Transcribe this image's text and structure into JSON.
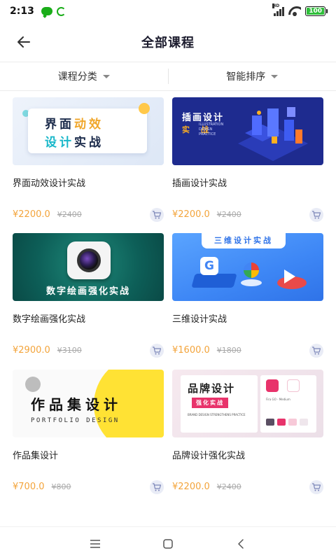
{
  "status_bar": {
    "time": "2:13",
    "battery": "100",
    "icons": [
      "wechat-icon",
      "sync-icon",
      "signal-icon",
      "wifi-icon",
      "battery-icon"
    ]
  },
  "header": {
    "title": "全部课程",
    "back_icon": "arrow-left-icon"
  },
  "filters": {
    "category_label": "课程分类",
    "sort_label": "智能排序"
  },
  "courses": [
    {
      "title": "界面动效设计实战",
      "price": "¥2200.0",
      "old_price": "¥2400",
      "thumb_line1_a": "界面",
      "thumb_line1_b": "动效",
      "thumb_line2_a": "设计",
      "thumb_line2_b": "实战"
    },
    {
      "title": "插画设计实战",
      "price": "¥2200.0",
      "old_price": "¥2400",
      "thumb_title": "插画设计",
      "thumb_sub": "实 战",
      "thumb_tiny": "ILLUSTRATION DESIGN PRACTICE"
    },
    {
      "title": "数字绘画强化实战",
      "price": "¥2900.0",
      "old_price": "¥3100",
      "thumb_text": "数字绘画强化实战"
    },
    {
      "title": "三维设计实战",
      "price": "¥1600.0",
      "old_price": "¥1800",
      "thumb_banner": "三维设计实战",
      "thumb_g": "G"
    },
    {
      "title": "作品集设计",
      "price": "¥700.0",
      "old_price": "¥800",
      "thumb_big": "作品集设计",
      "thumb_sub": "PORTFOLIO DESIGN"
    },
    {
      "title": "品牌设计强化实战",
      "price": "¥2200.0",
      "old_price": "¥2400",
      "thumb_title": "品牌设计",
      "thumb_badge": "强化实战",
      "thumb_small": "BRAND DESIGN STRENGTHENS PRACTICE",
      "thumb_font": "Fira GO - Medium"
    }
  ],
  "colors": {
    "price": "#f3a43b",
    "title": "#1c1c2e",
    "cart_bg": "#e9ecf6"
  },
  "navbar": {
    "icons": [
      "menu-icon",
      "home-icon",
      "back-icon"
    ]
  }
}
